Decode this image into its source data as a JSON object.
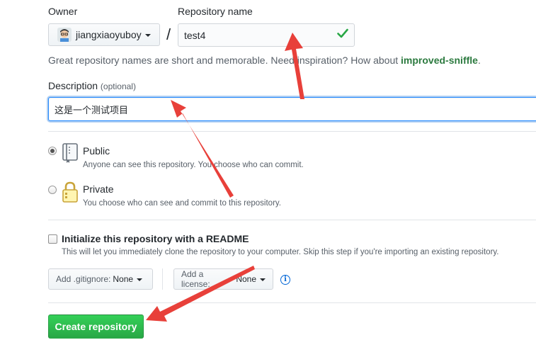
{
  "owner": {
    "label": "Owner",
    "name": "jiangxiaoyuboy"
  },
  "repository": {
    "label": "Repository name",
    "value": "test4",
    "slash": "/",
    "hint_prefix": "Great repository names are short and memorable. Need inspiration? How about ",
    "suggestion": "improved-sniffle",
    "hint_suffix": "."
  },
  "description": {
    "label": "Description",
    "optional": "(optional)",
    "value": "这是一个测试项目"
  },
  "visibility": {
    "public": {
      "title": "Public",
      "note": "Anyone can see this repository. You choose who can commit.",
      "selected": true
    },
    "private": {
      "title": "Private",
      "note": "You choose who can see and commit to this repository.",
      "selected": false
    }
  },
  "readme": {
    "title": "Initialize this repository with a README",
    "note": "This will let you immediately clone the repository to your computer. Skip this step if you're importing an existing repository.",
    "checked": false
  },
  "gitignore": {
    "label": "Add .gitignore:",
    "value": "None"
  },
  "license": {
    "label": "Add a license:",
    "value": "None"
  },
  "info_icon": "i",
  "create_button": "Create repository",
  "colors": {
    "accent_green": "#28a745",
    "annotation_red": "#e8403a",
    "link_blue": "#0366d6"
  }
}
